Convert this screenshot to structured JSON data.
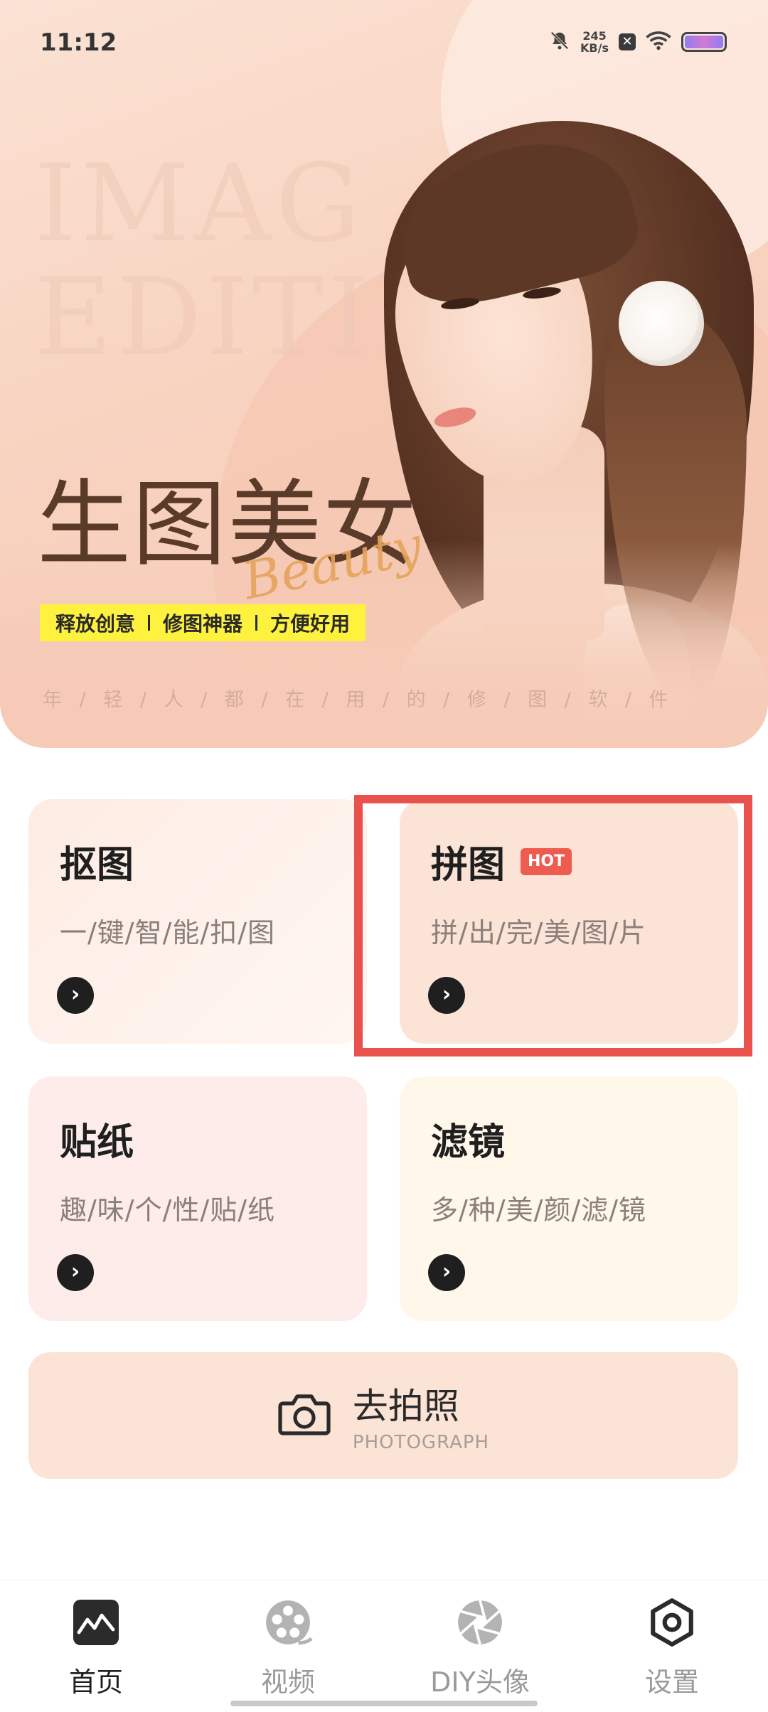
{
  "status_bar": {
    "time": "11:12",
    "speed_value": "245",
    "speed_unit": "KB/s"
  },
  "banner": {
    "watermark_line1": "IMAG",
    "watermark_line2": "EDITIN",
    "title": "生图美女",
    "script_word": "Beauty",
    "tags": [
      "释放创意",
      "修图神器",
      "方便好用"
    ],
    "subline": "年 / 轻 / 人 / 都 / 在 / 用 / 的 / 修 / 图 / 软 / 件"
  },
  "cards": [
    {
      "title": "抠图",
      "subtitle": "一/键/智/能/扣/图",
      "badge": ""
    },
    {
      "title": "拼图",
      "subtitle": "拼/出/完/美/图/片",
      "badge": "HOT"
    },
    {
      "title": "贴纸",
      "subtitle": "趣/味/个/性/贴/纸",
      "badge": ""
    },
    {
      "title": "滤镜",
      "subtitle": "多/种/美/颜/滤/镜",
      "badge": ""
    }
  ],
  "photograph": {
    "label": "去拍照",
    "sublabel": "PHOTOGRAPH",
    "icon": "camera-icon"
  },
  "nav": {
    "items": [
      {
        "label": "首页",
        "icon": "gallery-icon",
        "active": true
      },
      {
        "label": "视频",
        "icon": "film-reel-icon",
        "active": false
      },
      {
        "label": "DIY头像",
        "icon": "aperture-icon",
        "active": false
      },
      {
        "label": "设置",
        "icon": "hexagon-settings-icon",
        "active": false
      }
    ]
  },
  "colors": {
    "highlight_border": "#e9514c",
    "hot_badge": "#ee5b4f",
    "tagline_bg": "#fff23e",
    "accent_card": "#fbe3d6"
  }
}
